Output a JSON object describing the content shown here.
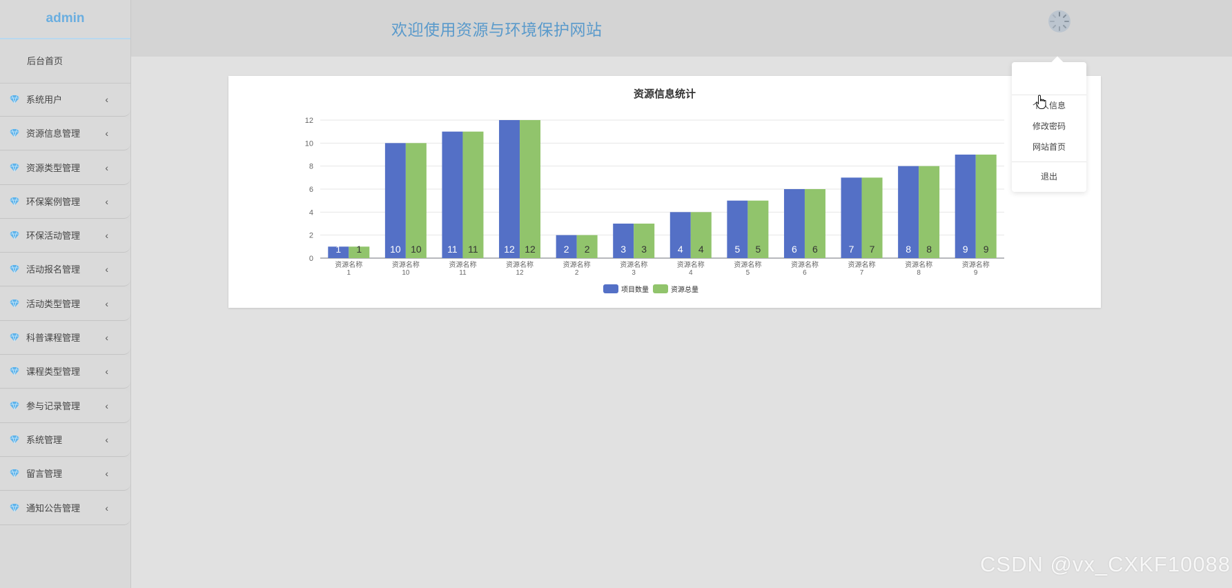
{
  "sidebar": {
    "brand": "admin",
    "home": "后台首页",
    "items": [
      {
        "label": "系统用户"
      },
      {
        "label": "资源信息管理"
      },
      {
        "label": "资源类型管理"
      },
      {
        "label": "环保案例管理"
      },
      {
        "label": "环保活动管理"
      },
      {
        "label": "活动报名管理"
      },
      {
        "label": "活动类型管理"
      },
      {
        "label": "科普课程管理"
      },
      {
        "label": "课程类型管理"
      },
      {
        "label": "参与记录管理"
      },
      {
        "label": "系统管理"
      },
      {
        "label": "留言管理"
      },
      {
        "label": "通知公告管理"
      }
    ],
    "chevron": "‹",
    "item_icon": "diamond-icon"
  },
  "header": {
    "title": "欢迎使用资源与环境保护网站",
    "spinner_icon": "loading-spinner-icon"
  },
  "dropdown": {
    "items": [
      "个人信息",
      "修改密码",
      "网站首页"
    ],
    "logout": "退出"
  },
  "colors": {
    "series1": "#5470c6",
    "series2": "#91c46c",
    "accent": "#6aaee0"
  },
  "chart_data": {
    "type": "bar",
    "title": "资源信息统计",
    "categories": [
      "资源名称1",
      "资源名称10",
      "资源名称11",
      "资源名称12",
      "资源名称2",
      "资源名称3",
      "资源名称4",
      "资源名称5",
      "资源名称6",
      "资源名称7",
      "资源名称8",
      "资源名称9"
    ],
    "series": [
      {
        "name": "项目数量",
        "values": [
          1,
          10,
          11,
          12,
          2,
          3,
          4,
          5,
          6,
          7,
          8,
          9
        ]
      },
      {
        "name": "资源总量",
        "values": [
          1,
          10,
          11,
          12,
          2,
          3,
          4,
          5,
          6,
          7,
          8,
          9
        ]
      }
    ],
    "ylim": [
      0,
      12
    ],
    "yticks": [
      0,
      2,
      4,
      6,
      8,
      10,
      12
    ],
    "grid": true,
    "legend": "bottom"
  },
  "watermark": "CSDN @vx_CXKF10088"
}
